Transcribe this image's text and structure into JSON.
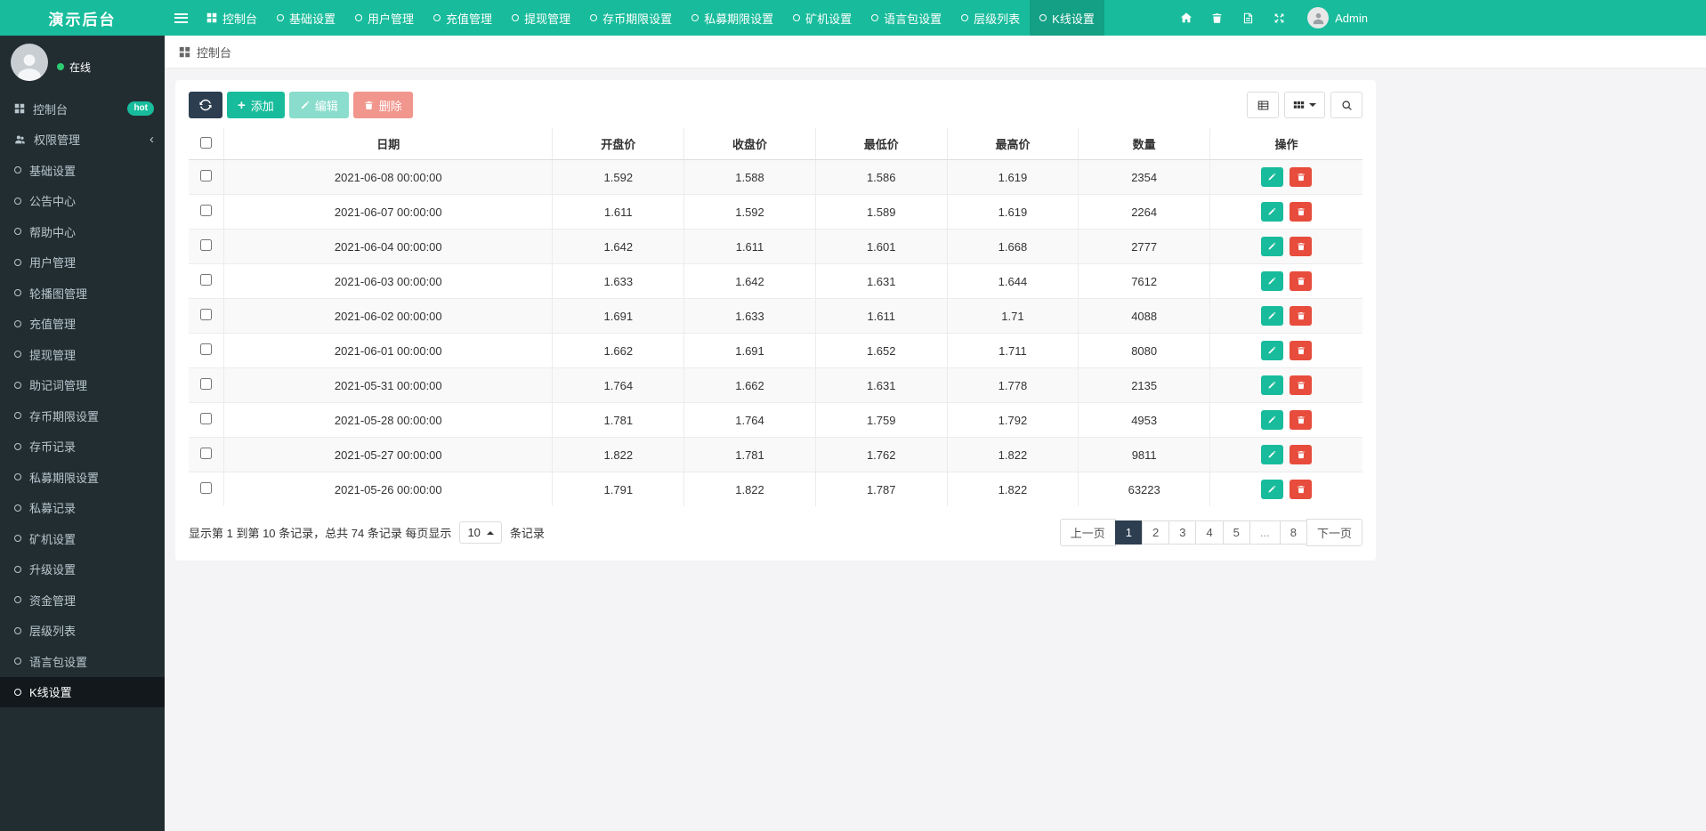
{
  "navbar": {
    "brand": "演示后台",
    "items": [
      {
        "label": "控制台",
        "dash": true
      },
      {
        "label": "基础设置",
        "circ": true
      },
      {
        "label": "用户管理",
        "circ": true
      },
      {
        "label": "充值管理",
        "circ": true
      },
      {
        "label": "提现管理",
        "circ": true
      },
      {
        "label": "存币期限设置",
        "circ": true
      },
      {
        "label": "私募期限设置",
        "circ": true
      },
      {
        "label": "矿机设置",
        "circ": true
      },
      {
        "label": "语言包设置",
        "circ": true
      },
      {
        "label": "层级列表",
        "circ": true
      },
      {
        "label": "K线设置",
        "circ": true,
        "active": true
      }
    ],
    "user": "Admin",
    "right_icons": [
      "home",
      "trash",
      "log",
      "fullscreen"
    ]
  },
  "sidebar": {
    "status": "在线",
    "items": [
      {
        "label": "控制台",
        "dash": true,
        "badge": "hot"
      },
      {
        "label": "权限管理",
        "users": true,
        "chevron": "‹"
      },
      {
        "label": "基础设置",
        "circ": true
      },
      {
        "label": "公告中心",
        "circ": true
      },
      {
        "label": "帮助中心",
        "circ": true
      },
      {
        "label": "用户管理",
        "circ": true
      },
      {
        "label": "轮播图管理",
        "circ": true
      },
      {
        "label": "充值管理",
        "circ": true
      },
      {
        "label": "提现管理",
        "circ": true
      },
      {
        "label": "助记词管理",
        "circ": true
      },
      {
        "label": "存币期限设置",
        "circ": true
      },
      {
        "label": "存币记录",
        "circ": true
      },
      {
        "label": "私募期限设置",
        "circ": true
      },
      {
        "label": "私募记录",
        "circ": true
      },
      {
        "label": "矿机设置",
        "circ": true
      },
      {
        "label": "升级设置",
        "circ": true
      },
      {
        "label": "资金管理",
        "circ": true
      },
      {
        "label": "层级列表",
        "circ": true
      },
      {
        "label": "语言包设置",
        "circ": true
      },
      {
        "label": "K线设置",
        "circ": true,
        "active": true
      }
    ]
  },
  "breadcrumb": {
    "label": "控制台"
  },
  "toolbar": {
    "add": "添加",
    "edit": "编辑",
    "del": "删除"
  },
  "table": {
    "headers": [
      "日期",
      "开盘价",
      "收盘价",
      "最低价",
      "最高价",
      "数量",
      "操作"
    ],
    "rows": [
      {
        "date": "2021-06-08 00:00:00",
        "open": "1.592",
        "close": "1.588",
        "low": "1.586",
        "high": "1.619",
        "qty": "2354"
      },
      {
        "date": "2021-06-07 00:00:00",
        "open": "1.611",
        "close": "1.592",
        "low": "1.589",
        "high": "1.619",
        "qty": "2264"
      },
      {
        "date": "2021-06-04 00:00:00",
        "open": "1.642",
        "close": "1.611",
        "low": "1.601",
        "high": "1.668",
        "qty": "2777"
      },
      {
        "date": "2021-06-03 00:00:00",
        "open": "1.633",
        "close": "1.642",
        "low": "1.631",
        "high": "1.644",
        "qty": "7612"
      },
      {
        "date": "2021-06-02 00:00:00",
        "open": "1.691",
        "close": "1.633",
        "low": "1.611",
        "high": "1.71",
        "qty": "4088"
      },
      {
        "date": "2021-06-01 00:00:00",
        "open": "1.662",
        "close": "1.691",
        "low": "1.652",
        "high": "1.711",
        "qty": "8080"
      },
      {
        "date": "2021-05-31 00:00:00",
        "open": "1.764",
        "close": "1.662",
        "low": "1.631",
        "high": "1.778",
        "qty": "2135"
      },
      {
        "date": "2021-05-28 00:00:00",
        "open": "1.781",
        "close": "1.764",
        "low": "1.759",
        "high": "1.792",
        "qty": "4953"
      },
      {
        "date": "2021-05-27 00:00:00",
        "open": "1.822",
        "close": "1.781",
        "low": "1.762",
        "high": "1.822",
        "qty": "9811"
      },
      {
        "date": "2021-05-26 00:00:00",
        "open": "1.791",
        "close": "1.822",
        "low": "1.787",
        "high": "1.822",
        "qty": "63223"
      }
    ]
  },
  "footer": {
    "info_before": "显示第 1 到第 10 条记录，总共 74 条记录 每页显示",
    "page_size": "10",
    "info_after": "条记录",
    "prev": "上一页",
    "next": "下一页",
    "pages": [
      {
        "label": "1",
        "active": true
      },
      {
        "label": "2"
      },
      {
        "label": "3"
      },
      {
        "label": "4"
      },
      {
        "label": "5"
      },
      {
        "label": "...",
        "ellipsis": true
      },
      {
        "label": "8"
      }
    ]
  },
  "colors": {
    "primary": "#18BC9C",
    "navy": "#2C3E50",
    "danger": "#E74C3C",
    "sidebar_bg": "#222D32"
  }
}
